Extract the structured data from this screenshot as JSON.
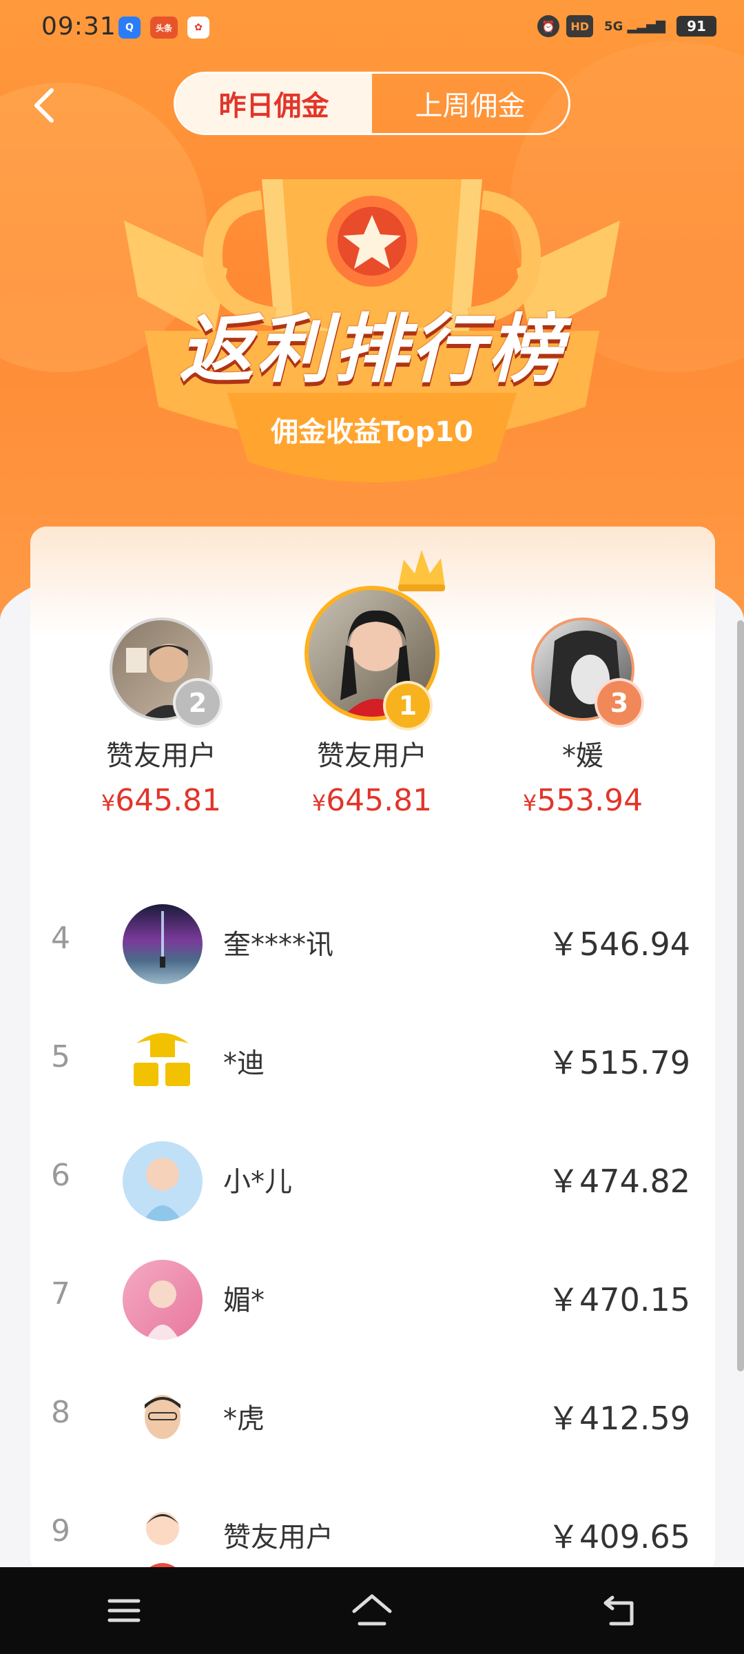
{
  "status": {
    "time": "09:31",
    "app1": "Q",
    "app2": "头条",
    "hd": "HD",
    "net": "5G",
    "battery": "91"
  },
  "tabs": [
    {
      "label": "昨日佣金",
      "active": true
    },
    {
      "label": "上周佣金",
      "active": false
    }
  ],
  "hero": {
    "title": "返利排行榜",
    "subtitle": "佣金收益Top10"
  },
  "currency": "¥",
  "podium": [
    {
      "rank": "2",
      "name": "赞友用户",
      "amount": "645.81"
    },
    {
      "rank": "1",
      "name": "赞友用户",
      "amount": "645.81"
    },
    {
      "rank": "3",
      "name": "*媛",
      "amount": "553.94"
    }
  ],
  "list": [
    {
      "rank": "4",
      "name": "奎****讯",
      "amount": "￥546.94"
    },
    {
      "rank": "5",
      "name": "*迪",
      "amount": "￥515.79"
    },
    {
      "rank": "6",
      "name": "小*儿",
      "amount": "￥474.82"
    },
    {
      "rank": "7",
      "name": "媚*",
      "amount": "￥470.15"
    },
    {
      "rank": "8",
      "name": "*虎",
      "amount": "￥412.59"
    },
    {
      "rank": "9",
      "name": "赞友用户",
      "amount": "￥409.65"
    }
  ],
  "colors": {
    "accent": "#ff8a34",
    "price": "#e2352a",
    "gold": "#f5a623",
    "silver": "#b9b9b9",
    "bronze": "#f08a5d"
  }
}
